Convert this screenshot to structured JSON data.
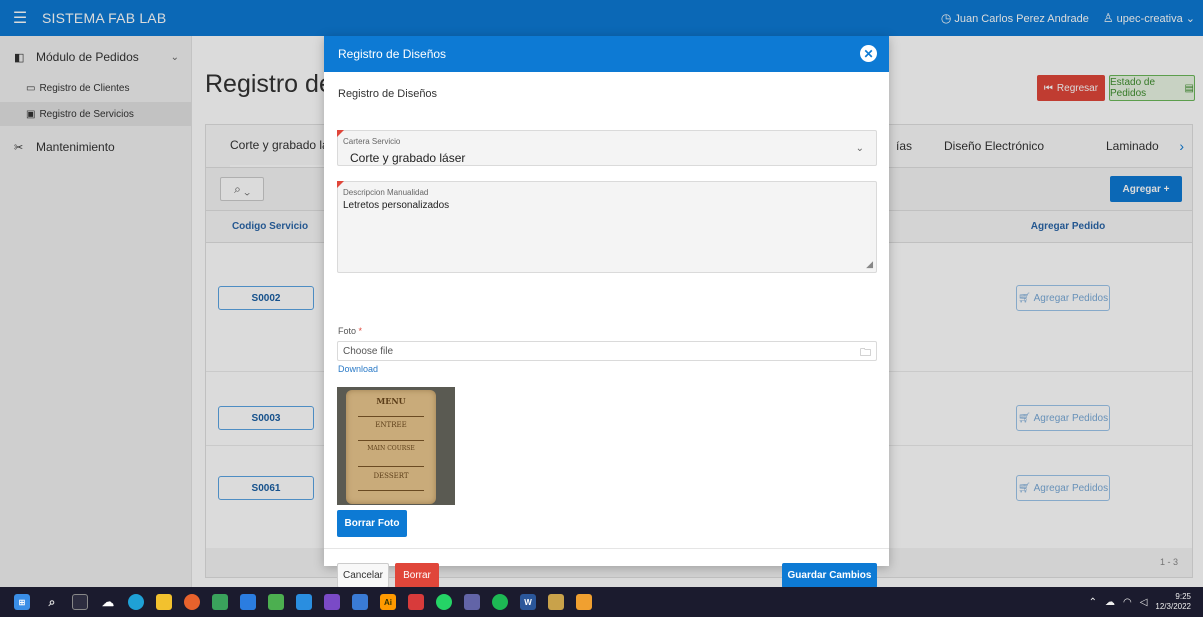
{
  "topbar": {
    "app_title": "SISTEMA FAB LAB",
    "user_name": "Juan Carlos Perez Andrade",
    "org": "upec-creativa"
  },
  "sidebar": {
    "group_pedidos": "Módulo de Pedidos",
    "items": [
      {
        "label": "Registro de Clientes"
      },
      {
        "label": "Registro de Servicios"
      }
    ],
    "group_mantenimiento": "Mantenimiento"
  },
  "main": {
    "title": "Registro de",
    "btn_regresar": "Regresar",
    "btn_estado": "Estado de Pedidos",
    "tabs": [
      {
        "label": "Corte y grabado lá"
      },
      {
        "label": "ías"
      },
      {
        "label": "Diseño Electrónico"
      },
      {
        "label": "Laminado"
      }
    ],
    "btn_agregar": "Agregar +",
    "columns": {
      "codigo": "Codigo Servicio",
      "agregar": "Agregar Pedido"
    },
    "rows": [
      {
        "code": "S0002",
        "action": "Agregar Pedidos"
      },
      {
        "code": "S0003",
        "action": "Agregar Pedidos"
      },
      {
        "code": "S0061",
        "action": "Agregar Pedidos"
      }
    ],
    "pagination": "1 - 3"
  },
  "modal": {
    "title": "Registro de Diseños",
    "subtitle": "Registro de Diseños",
    "cartera_label": "Cartera Servicio",
    "cartera_value": "Corte y grabado láser",
    "descripcion_label": "Descripcion Manualidad",
    "descripcion_value": "Letretos personalizados",
    "foto_label": "Foto",
    "foto_required": "*",
    "file_placeholder": "Choose file",
    "download": "Download",
    "photo_text": {
      "menu": "MENU",
      "entree": "ENTREE",
      "main_course": "MAIN COURSE",
      "dessert": "DESSERT"
    },
    "btn_borrar_foto": "Borrar Foto",
    "btn_cancelar": "Cancelar",
    "btn_borrar": "Borrar",
    "btn_guardar": "Guardar Cambios"
  },
  "taskbar": {
    "time": "9:25",
    "date": "12/3/2022"
  },
  "colors": {
    "primary": "#0d7ad4",
    "danger": "#e0463a",
    "success": "#6cb85a"
  }
}
